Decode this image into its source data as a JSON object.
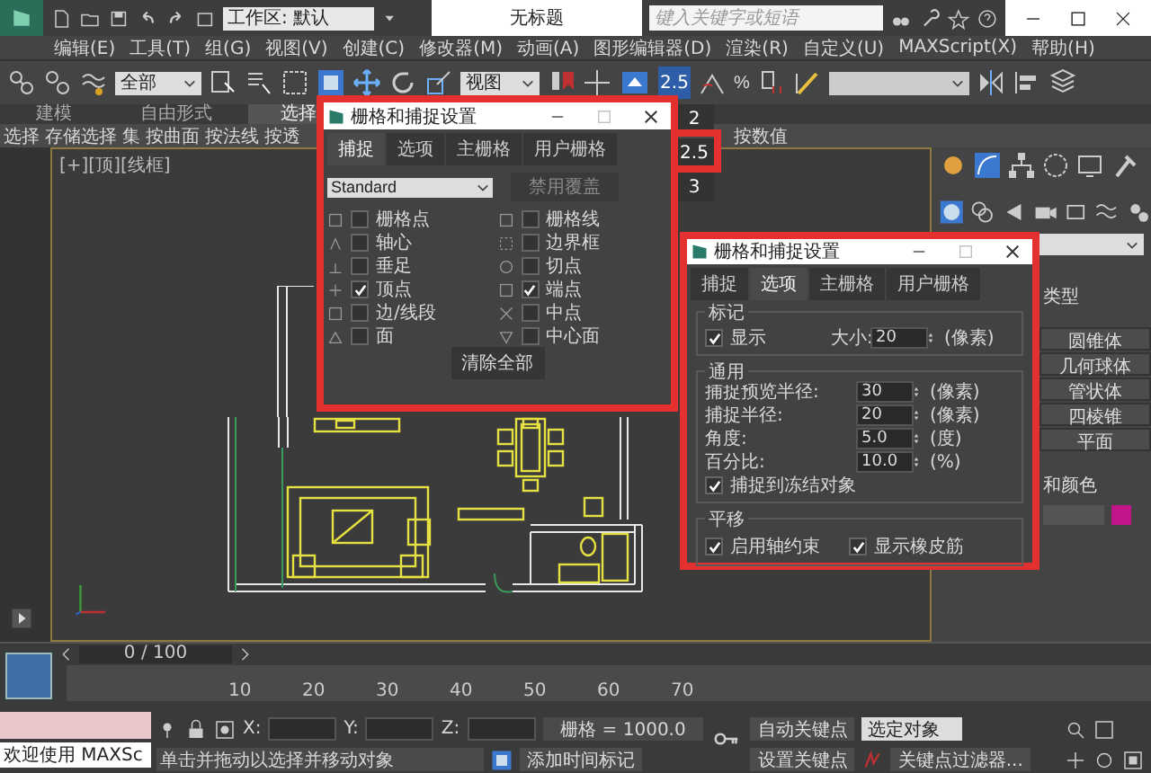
{
  "window": {
    "workspace": "工作区: 默认",
    "title": "无标题",
    "search": {
      "placeholder": "键入关键字或短语"
    }
  },
  "menu": [
    "编辑(E)",
    "工具(T)",
    "组(G)",
    "视图(V)",
    "创建(C)",
    "修改器(M)",
    "动画(A)",
    "图形编辑器(D)",
    "渲染(R)",
    "自定义(U)",
    "MAXScript(X)",
    "帮助(H)"
  ],
  "toolbar": {
    "selection_filter": "全部",
    "reference_coord": "视图",
    "snap_toggle": "2.5",
    "percent_snap": "%"
  },
  "ribbon": {
    "tabs": [
      {
        "label": "建模",
        "selected": false
      },
      {
        "label": "自由形式",
        "selected": false
      },
      {
        "label": "选择",
        "selected": true
      }
    ],
    "commands": [
      "选择",
      "存储选择",
      "集",
      "按曲面",
      "按法线",
      "按透"
    ],
    "commands_right": [
      "按数值"
    ]
  },
  "snap_flyout": [
    "2",
    "2.5",
    "3"
  ],
  "viewport": {
    "label": "[+][顶][线框]"
  },
  "command_panel": {
    "rollout": "类型",
    "buttons": [
      "圆锥体",
      "几何球体",
      "管状体",
      "四棱锥",
      "平面"
    ],
    "rollout_2": "和颜色"
  },
  "snap_dialog": {
    "title": "栅格和捕捉设置",
    "tabs": [
      {
        "label": "捕捉",
        "selected": true
      },
      {
        "label": "选项",
        "selected": false
      },
      {
        "label": "主栅格",
        "selected": false
      },
      {
        "label": "用户栅格",
        "selected": false
      }
    ],
    "preset": "Standard",
    "override_button": "禁用覆盖",
    "snap_types": [
      {
        "label": "栅格点",
        "checked": false
      },
      {
        "label": "栅格线",
        "checked": false
      },
      {
        "label": "轴心",
        "checked": false
      },
      {
        "label": "边界框",
        "checked": false
      },
      {
        "label": "垂足",
        "checked": false
      },
      {
        "label": "切点",
        "checked": false
      },
      {
        "label": "顶点",
        "checked": true
      },
      {
        "label": "端点",
        "checked": true
      },
      {
        "label": "边/线段",
        "checked": false
      },
      {
        "label": "中点",
        "checked": false
      },
      {
        "label": "面",
        "checked": false
      },
      {
        "label": "中心面",
        "checked": false
      }
    ],
    "clear_button": "清除全部"
  },
  "options_dialog": {
    "title": "栅格和捕捉设置",
    "tabs": [
      {
        "label": "捕捉",
        "selected": false
      },
      {
        "label": "选项",
        "selected": true
      },
      {
        "label": "主栅格",
        "selected": false
      },
      {
        "label": "用户栅格",
        "selected": false
      }
    ],
    "marker": {
      "heading": "标记",
      "display": {
        "label": "显示",
        "checked": true
      },
      "size_label": "大小:",
      "size": "20",
      "size_unit": "(像素)"
    },
    "general": {
      "heading": "通用",
      "fields": [
        {
          "label": "捕捉预览半径:",
          "value": "30",
          "unit": "(像素)"
        },
        {
          "label": "捕捉半径:",
          "value": "20",
          "unit": "(像素)"
        },
        {
          "label": "角度:",
          "value": "5.0",
          "unit": "(度)"
        },
        {
          "label": "百分比:",
          "value": "10.0",
          "unit": "(%)"
        }
      ],
      "snap_frozen": {
        "label": "捕捉到冻结对象",
        "checked": true
      }
    },
    "translation": {
      "heading": "平移",
      "options": [
        {
          "label": "启用轴约束",
          "checked": true
        },
        {
          "label": "显示橡皮筋",
          "checked": true
        }
      ]
    }
  },
  "timeline": {
    "position": "0 / 100",
    "ticks": [
      "10",
      "20",
      "30",
      "40",
      "50",
      "60",
      "70"
    ]
  },
  "status": {
    "welcome": "欢迎使用 MAXSc",
    "x_label": "X:",
    "y_label": "Y:",
    "z_label": "Z:",
    "grid": "栅格 = 1000.0",
    "auto_key": "自动关键点",
    "key_target": "选定对象",
    "set_key": "设置关键点",
    "key_filters": "关键点过滤器...",
    "prompt": "单击并拖动以选择并移动对象",
    "add_time_tag": "添加时间标记"
  }
}
